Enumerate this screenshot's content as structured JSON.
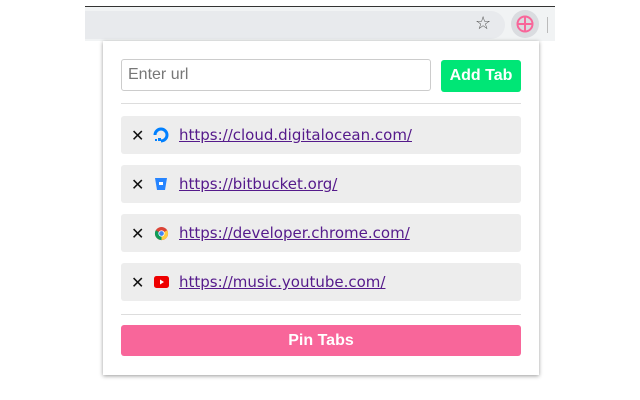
{
  "toolbar": {
    "star_icon": "star-icon",
    "extension_icon": "pin-tabs-extension-icon"
  },
  "popup": {
    "url_placeholder": "Enter url",
    "url_value": "",
    "add_label": "Add Tab",
    "tabs": [
      {
        "url": "https://cloud.digitalocean.com/",
        "icon": "digitalocean-icon"
      },
      {
        "url": "https://bitbucket.org/",
        "icon": "bitbucket-icon"
      },
      {
        "url": "https://developer.chrome.com/",
        "icon": "chrome-icon"
      },
      {
        "url": "https://music.youtube.com/",
        "icon": "youtube-icon"
      }
    ],
    "remove_label": "✕",
    "pin_label": "Pin Tabs"
  },
  "colors": {
    "add": "#00e676",
    "pin": "#f8669a",
    "link": "#551a8b"
  }
}
